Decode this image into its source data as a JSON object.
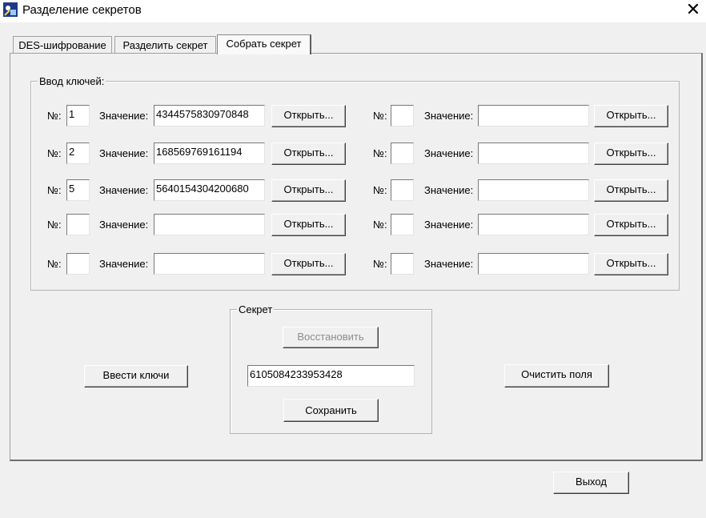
{
  "window": {
    "title": "Разделение секретов",
    "icon": "app-icon",
    "close_glyph": "✕"
  },
  "tabs": [
    {
      "label": "DES-шифрование",
      "active": false
    },
    {
      "label": "Разделить секрет",
      "active": false
    },
    {
      "label": "Собрать секрет",
      "active": true
    }
  ],
  "keys_group": {
    "legend": "Ввод ключей:",
    "num_label": "№:",
    "value_label": "Значение:",
    "open_label": "Открыть...",
    "left": [
      {
        "num": "1",
        "value": "4344575830970848"
      },
      {
        "num": "2",
        "value": "168569769161194"
      },
      {
        "num": "5",
        "value": "5640154304200680"
      },
      {
        "num": "",
        "value": ""
      },
      {
        "num": "",
        "value": ""
      }
    ],
    "right": [
      {
        "num": "",
        "value": ""
      },
      {
        "num": "",
        "value": ""
      },
      {
        "num": "",
        "value": ""
      },
      {
        "num": "",
        "value": ""
      },
      {
        "num": "",
        "value": ""
      }
    ]
  },
  "secret_group": {
    "legend": "Секрет",
    "restore_label": "Восстановить",
    "value": "6105084233953428",
    "save_label": "Сохранить"
  },
  "actions": {
    "enter_keys_label": "Ввести ключи",
    "clear_label": "Очистить поля",
    "exit_label": "Выход"
  }
}
